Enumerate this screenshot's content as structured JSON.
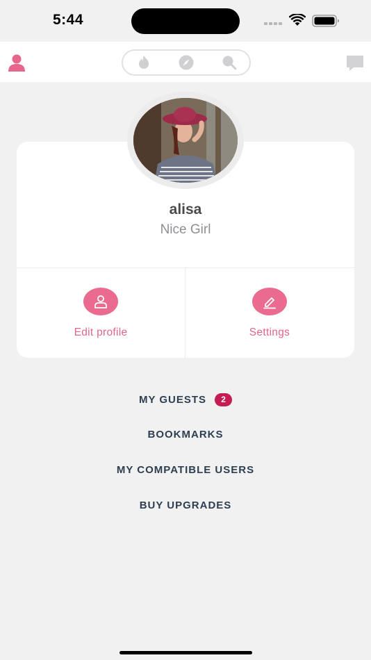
{
  "status": {
    "time": "5:44"
  },
  "nav": {
    "tabs": [
      {
        "icon": "flame-icon"
      },
      {
        "icon": "compass-icon"
      },
      {
        "icon": "search-icon"
      }
    ]
  },
  "profile": {
    "name": "alisa",
    "subtitle": "Nice Girl"
  },
  "actions": {
    "edit_label": "Edit profile",
    "settings_label": "Settings"
  },
  "menu": {
    "guests_label": "MY GUESTS",
    "guests_count": "2",
    "bookmarks_label": "BOOKMARKS",
    "compatible_label": "MY COMPATIBLE USERS",
    "upgrades_label": "BUY UPGRADES"
  },
  "colors": {
    "accent": "#ea6b8f",
    "badge": "#c51d51",
    "menu_text": "#2c3e50",
    "background": "#f1f1f2"
  }
}
